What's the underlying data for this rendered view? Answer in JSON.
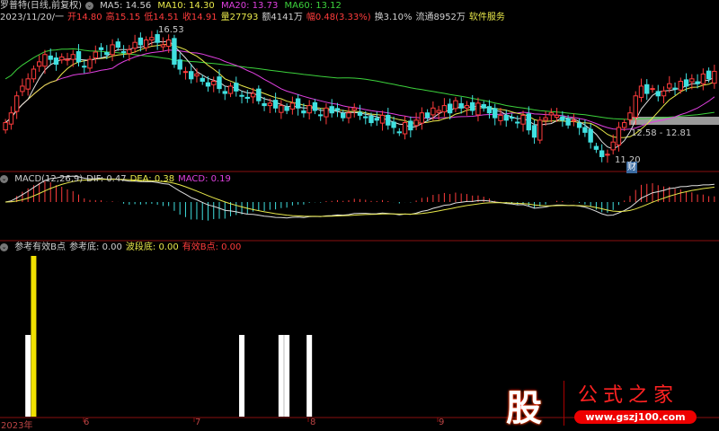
{
  "header": {
    "stock_name": "罗普特(日线,前复权)",
    "ma5": "MA5: 14.56",
    "ma10": "MA10: 14.30",
    "ma20": "MA20: 13.73",
    "ma60": "MA60: 13.12"
  },
  "quote": {
    "date": "2023/11/20/一",
    "open": "开14.80",
    "high": "高15.15",
    "low": "低14.51",
    "close": "收14.91",
    "volume": "量27793",
    "amount": "额4141万",
    "change": "幅0.48(3.33%)",
    "turnover": "换3.10%",
    "float": "流通8952万",
    "sector": "软件服务"
  },
  "annotations": {
    "high_label": "16.53",
    "low_label": "11.20",
    "range_label": "12.58 - 12.81",
    "event_badge": "财"
  },
  "macd": {
    "title": "MACD(12,26,9)",
    "dif": "DIF: 0.47",
    "dea": "DEA: 0.38",
    "macd": "MACD: 0.19"
  },
  "indicator": {
    "title": "参考有效B点",
    "ref_bottom": "参考底: 0.00",
    "wave_bottom": "波段底: 0.00",
    "valid_b": "有效B点: 0.00"
  },
  "x_axis": {
    "labels": [
      "2023年",
      "6",
      "7",
      "8",
      "9"
    ]
  },
  "watermark": {
    "char": "股",
    "name": "公式之家",
    "url": "www.gszj100.com"
  },
  "chart_data": {
    "type": "candlestick",
    "closes": [
      12.8,
      13.2,
      13.9,
      14.3,
      14.6,
      15.0,
      15.3,
      15.6,
      15.4,
      15.2,
      15.5,
      15.4,
      15.6,
      15.3,
      15.1,
      15.4,
      15.7,
      15.8,
      15.6,
      16.0,
      15.9,
      15.7,
      15.8,
      16.1,
      16.0,
      16.2,
      16.3,
      16.1,
      16.0,
      16.2,
      15.2,
      15.0,
      14.9,
      14.6,
      14.8,
      14.5,
      14.3,
      14.5,
      14.2,
      14.0,
      14.3,
      14.1,
      13.9,
      13.8,
      14.0,
      13.7,
      13.5,
      13.6,
      13.4,
      13.5,
      13.3,
      13.6,
      13.4,
      13.2,
      13.5,
      13.3,
      13.1,
      13.4,
      13.2,
      13.3,
      13.0,
      13.2,
      13.4,
      13.1,
      13.0,
      12.8,
      12.9,
      13.1,
      12.7,
      12.6,
      12.4,
      12.8,
      12.5,
      12.9,
      13.2,
      13.0,
      13.4,
      13.3,
      13.5,
      13.2,
      13.7,
      13.4,
      13.5,
      13.3,
      13.6,
      13.4,
      13.2,
      13.0,
      13.1,
      12.9,
      13.0,
      12.8,
      13.1,
      12.5,
      12.2,
      12.9,
      13.0,
      13.2,
      13.1,
      12.9,
      12.7,
      12.9,
      12.6,
      12.4,
      12.0,
      11.7,
      11.4,
      11.5,
      12.0,
      12.6,
      12.8,
      13.2,
      13.9,
      14.3,
      14.0,
      14.2,
      13.9,
      14.1,
      14.4,
      14.2,
      14.5,
      14.3,
      14.6,
      14.4,
      14.8,
      14.6,
      14.91
    ],
    "price_range": [
      10.9,
      17.4
    ],
    "signals": [
      {
        "index": 4,
        "type": "white"
      },
      {
        "index": 5,
        "type": "yellow"
      },
      {
        "index": 42,
        "type": "white"
      },
      {
        "index": 49,
        "type": "white"
      },
      {
        "index": 50,
        "type": "white"
      },
      {
        "index": 54,
        "type": "white"
      }
    ],
    "colors": {
      "up": "#ff3c3c",
      "down": "#40e0e0",
      "ma5": "#e0e0e0",
      "ma10": "#e8e84a",
      "ma20": "#e040e0",
      "ma60": "#3cd23c"
    }
  }
}
